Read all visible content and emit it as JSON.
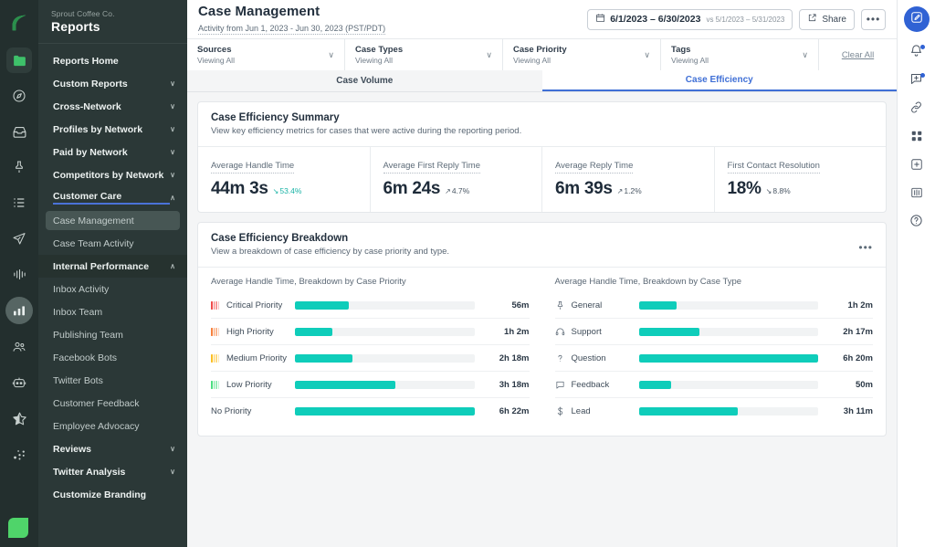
{
  "left_rail": {
    "logo": "sprout-leaf-logo",
    "items": [
      {
        "icon": "folder-icon",
        "name": "home-folder",
        "state": "boxed"
      },
      {
        "icon": "compass-icon",
        "name": "dashboard"
      },
      {
        "icon": "inbox-icon",
        "name": "inbox"
      },
      {
        "icon": "pin-icon",
        "name": "publishing"
      },
      {
        "icon": "list-icon",
        "name": "tasks"
      },
      {
        "icon": "send-icon",
        "name": "compose"
      },
      {
        "icon": "waveform-icon",
        "name": "listening"
      },
      {
        "icon": "bar-chart-icon",
        "name": "reports",
        "state": "active"
      },
      {
        "icon": "people-icon",
        "name": "audience"
      },
      {
        "icon": "robot-icon",
        "name": "bots"
      },
      {
        "icon": "star-half-icon",
        "name": "reviews"
      },
      {
        "icon": "nodes-icon",
        "name": "integrations"
      }
    ],
    "bottom_icon": "profile-avatar"
  },
  "sidebar": {
    "org": "Sprout Coffee Co.",
    "title": "Reports",
    "items": [
      {
        "label": "Reports Home",
        "type": "top",
        "chevron": ""
      },
      {
        "label": "Custom Reports",
        "type": "top",
        "chevron": "∨"
      },
      {
        "label": "Cross-Network",
        "type": "top",
        "chevron": "∨"
      },
      {
        "label": "Profiles by Network",
        "type": "top",
        "chevron": "∨"
      },
      {
        "label": "Paid by Network",
        "type": "top",
        "chevron": "∨"
      },
      {
        "label": "Competitors by Network",
        "type": "top",
        "chevron": "∨"
      },
      {
        "label": "Customer Care",
        "type": "top-active",
        "chevron": "∧"
      },
      {
        "label": "Case Management",
        "type": "sub-selected",
        "chevron": ""
      },
      {
        "label": "Case Team Activity",
        "type": "sub",
        "chevron": ""
      },
      {
        "label": "Internal Performance",
        "type": "top-open",
        "chevron": "∧"
      },
      {
        "label": "Inbox Activity",
        "type": "sub",
        "chevron": ""
      },
      {
        "label": "Inbox Team",
        "type": "sub",
        "chevron": ""
      },
      {
        "label": "Publishing Team",
        "type": "sub",
        "chevron": ""
      },
      {
        "label": "Facebook Bots",
        "type": "sub",
        "chevron": ""
      },
      {
        "label": "Twitter Bots",
        "type": "sub",
        "chevron": ""
      },
      {
        "label": "Customer Feedback",
        "type": "sub",
        "chevron": ""
      },
      {
        "label": "Employee Advocacy",
        "type": "sub",
        "chevron": ""
      },
      {
        "label": "Reviews",
        "type": "top",
        "chevron": "∨"
      },
      {
        "label": "Twitter Analysis",
        "type": "top",
        "chevron": "∨"
      },
      {
        "label": "Customize Branding",
        "type": "top",
        "chevron": ""
      }
    ]
  },
  "header": {
    "title": "Case Management",
    "subtitle": "Activity from Jun 1, 2023 - Jun 30, 2023 (PST/PDT)",
    "date_range": "6/1/2023 – 6/30/2023",
    "date_compare": "vs 5/1/2023 – 5/31/2023",
    "share_label": "Share",
    "more_label": "•••"
  },
  "filters": [
    {
      "label": "Sources",
      "value": "Viewing All"
    },
    {
      "label": "Case Types",
      "value": "Viewing All"
    },
    {
      "label": "Case Priority",
      "value": "Viewing All"
    },
    {
      "label": "Tags",
      "value": "Viewing All"
    }
  ],
  "clear_all": "Clear All",
  "tabs": [
    {
      "label": "Case Volume",
      "active": false
    },
    {
      "label": "Case Efficiency",
      "active": true
    }
  ],
  "summary_card": {
    "title": "Case Efficiency Summary",
    "description": "View key efficiency metrics for cases that were active during the reporting period.",
    "metrics": [
      {
        "label": "Average Handle Time",
        "value": "44m 3s",
        "delta": "53.4%",
        "direction": "down",
        "color": "#19b3a6"
      },
      {
        "label": "Average First Reply Time",
        "value": "6m 24s",
        "delta": "4.7%",
        "direction": "up",
        "color": "#4b5865"
      },
      {
        "label": "Average Reply Time",
        "value": "6m 39s",
        "delta": "1.2%",
        "direction": "up",
        "color": "#4b5865"
      },
      {
        "label": "First Contact Resolution",
        "value": "18%",
        "delta": "8.8%",
        "direction": "down",
        "color": "#4b5865"
      }
    ]
  },
  "breakdown_card": {
    "title": "Case Efficiency Breakdown",
    "description": "View a breakdown of case efficiency by case priority and type.",
    "menu_label": "•••",
    "left_caption": "Average Handle Time, Breakdown by Case Priority",
    "right_caption": "Average Handle Time, Breakdown by Case Type"
  },
  "chart_data": [
    {
      "type": "bar",
      "title": "Average Handle Time, Breakdown by Case Priority",
      "orientation": "horizontal",
      "xlabel": "",
      "ylabel": "",
      "bar_color": "#0fcdba",
      "track_color": "#f1f3f4",
      "categories": [
        "Critical Priority",
        "High Priority",
        "Medium Priority",
        "Low Priority",
        "No Priority"
      ],
      "value_labels": [
        "56m",
        "1h 2m",
        "2h 18m",
        "3h 18m",
        "6h 22m"
      ],
      "values_minutes": [
        56,
        62,
        138,
        198,
        382
      ],
      "pct": [
        30,
        21,
        32,
        56,
        100
      ],
      "icons": [
        "priority-critical-icon",
        "priority-high-icon",
        "priority-medium-icon",
        "priority-low-icon",
        ""
      ],
      "icon_colors": [
        "#f04a4a",
        "#f7803c",
        "#fbbf24",
        "#4ade80",
        ""
      ]
    },
    {
      "type": "bar",
      "title": "Average Handle Time, Breakdown by Case Type",
      "orientation": "horizontal",
      "xlabel": "",
      "ylabel": "",
      "bar_color": "#0fcdba",
      "track_color": "#f1f3f4",
      "categories": [
        "General",
        "Support",
        "Question",
        "Feedback",
        "Lead"
      ],
      "value_labels": [
        "1h 2m",
        "2h 17m",
        "6h 20m",
        "50m",
        "3h 11m"
      ],
      "values_minutes": [
        62,
        137,
        380,
        50,
        191
      ],
      "pct": [
        21,
        34,
        100,
        18,
        55
      ],
      "icons": [
        "pin-icon",
        "headset-icon",
        "question-mark-icon",
        "speech-bubble-icon",
        "dollar-sign-icon"
      ]
    }
  ],
  "right_rail": {
    "items": [
      {
        "icon": "compose-pencil-icon",
        "name": "compose",
        "primary": true,
        "badge": false
      },
      {
        "icon": "bell-icon",
        "name": "notifications",
        "primary": false,
        "badge": true
      },
      {
        "icon": "message-plus-icon",
        "name": "messages",
        "primary": false,
        "badge": true
      },
      {
        "icon": "link-icon",
        "name": "links",
        "primary": false,
        "badge": false
      },
      {
        "icon": "grid-apps-icon",
        "name": "apps",
        "primary": false,
        "badge": false
      },
      {
        "icon": "plus-box-icon",
        "name": "add",
        "primary": false,
        "badge": false
      },
      {
        "icon": "book-icon",
        "name": "library",
        "primary": false,
        "badge": false
      },
      {
        "icon": "help-circle-icon",
        "name": "help",
        "primary": false,
        "badge": false
      }
    ]
  }
}
